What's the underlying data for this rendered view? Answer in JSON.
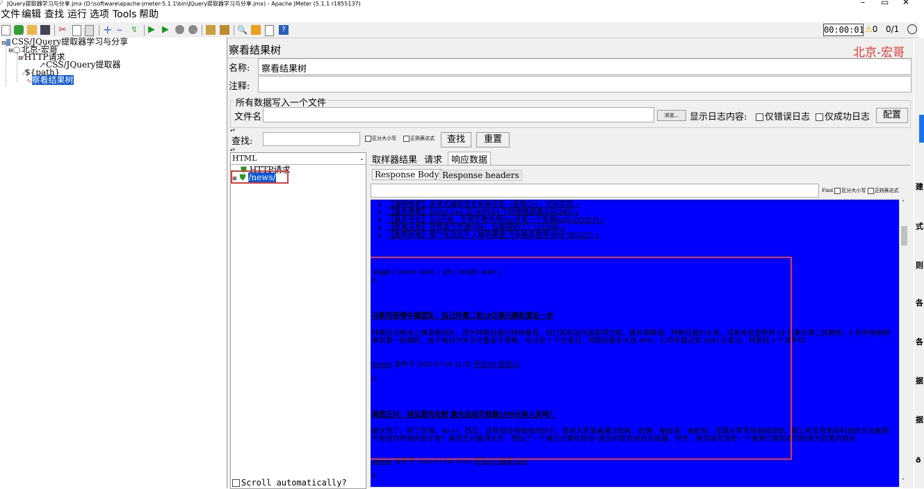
{
  "window": {
    "title": "JQuery提取器学习与分享.jmx (D:\\software\\apache-jmeter-5.1.1\\bin\\JQuery提取器学习与分享.jmx) - Apache JMeter (5.1.1 r1855137)",
    "minimize": "–",
    "maximize": "▭",
    "close": "✕"
  },
  "menu": [
    "文件",
    "编辑",
    "查找",
    "运行",
    "选项",
    "Tools",
    "帮助"
  ],
  "toolbar": {
    "timer": "00:00:01",
    "warnings": "0",
    "threads": "0/1"
  },
  "tree": {
    "root": "CSS/JQuery提取器学习与分享",
    "thread_group": "北京-宏哥",
    "http_request": "HTTP请求",
    "extractor": "CSS/JQuery提取器",
    "path_var": "${path}",
    "listener": "察看结果树"
  },
  "panel": {
    "title": "察看结果树",
    "watermark": "北京-宏哥",
    "name_label": "名称:",
    "name_value": "察看结果树",
    "comment_label": "注释:",
    "comment_value": "",
    "file_section": "所有数据写入一个文件",
    "filename_label": "文件名",
    "browse": "浏览...",
    "log_label": "显示日志内容:",
    "errors_only": "仅错误日志",
    "success_only": "仅成功日志",
    "config": "配置",
    "search_label": "查找:",
    "case_sensitive": "区分大小写",
    "regex": "正则表达式",
    "search_btn": "查找",
    "reset_btn": "重置",
    "renderer": "HTML",
    "result_items": [
      "HTTP请求",
      "/news/"
    ],
    "scroll_auto": "Scroll automatically?",
    "tabs": [
      "取样器结果",
      "请求",
      "响应数据"
    ],
    "subtabs": [
      "Response Body",
      "Response headers"
    ],
    "find_label": "Find",
    "find_case": "区分大小写",
    "find_regex": "正则表达式"
  },
  "content": {
    "bullets": [
      "【编辑推荐】逐渐式编程语言前端实现（使用C#）：代码实现 »",
      "【最多推荐】dotnet core 在 MIPS64 下的移植进度(16/1345) »",
      "【最多评论】从0开始，手把手教你用Vue开发一个答题App(10/1017) »",
      "【新闻头条】世界首个开源PDK，谷歌做到了！(1/1269) »",
      "【推荐新闻】哪个车流后千人堆积遭遇 汽车融资租赁“异化”(8/1167) »"
    ],
    "css_line": ".diggit { cursor: auto; } .pfs { height: auto; }",
    "zero1": "0",
    "news1_title": "马斯克获得中国团队：自己所第二批18亿美元期权更近一步",
    "news1_body": "特斯拉马斯克心情是愉快的，因为特斯拉股价持续暴涨，自己的权益也是即将兑现。据外媒报道，特斯拉股价大涨，马斯克有望获得 18 亿美元第二批期权。5 月份他刚刚拿到第一批期权，由于电动汽车交付量高于预期，在过去 7 个交易日，特斯拉股价大涨 46%，公司市值达到 2590 亿美元。特斯拉 6 个月平均",
    "news1_meta_user": "itwriter",
    "news1_meta_text": " 发布于 2020-07-09 11:01 ",
    "news1_meta_links": "评论(0) 阅读(1)",
    "zero2": "0",
    "news2_title": "美团王兴：保证室内无蚊 激光自动灭蚊器1999元有人买吗？",
    "news2_body": "夏天到了，除了空调、Wi-Fi、西瓜，还有到处嗡嗡嗡的蚊子。目前大家普遍通过蚊帐、蚊香、电蚊液、电蚊拍、花露水等手段驱蚊除蚊。那么有没有更高科技的方法能够干掉室内所有的蚊子呢？美团王兴脑洞大开，想出了一个通过计算机视觉+激光的室内自动灭蚊器。昨天，他在饭否发布一个使用计算机视觉和激光的室内自动",
    "news2_meta_user": "itwriter",
    "news2_meta_text": " 发布于 2020-07-09 10:51 ",
    "news2_meta_links": "评论(2) 阅读(118)",
    "zero3": "0"
  },
  "strip_chars": [
    "建",
    "式",
    "则",
    "各",
    "各",
    "据",
    "据",
    "ð"
  ],
  "colors": {
    "content_bg": "#0000ff",
    "selection": "#0a56d8",
    "annotation": "#e53935",
    "watermark": "#e53935"
  }
}
